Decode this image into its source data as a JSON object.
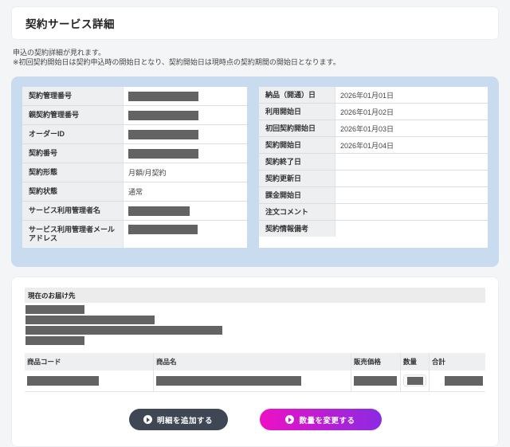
{
  "page": {
    "title": "契約サービス詳細",
    "note_line1": "申込の契約詳細が見れます。",
    "note_line2": "※初回契約開始日は契約申込時の開始日となり、契約開始日は現時点の契約期間の開始日となります。"
  },
  "contract": {
    "left_rows": [
      {
        "label": "契約管理番号",
        "value": "",
        "redacted": true
      },
      {
        "label": "親契約管理番号",
        "value": "",
        "redacted": true
      },
      {
        "label": "オーダーID",
        "value": "",
        "redacted": true
      },
      {
        "label": "契約番号",
        "value": "",
        "redacted": true
      },
      {
        "label": "契約形態",
        "value": "月額/月契約",
        "redacted": false
      },
      {
        "label": "契約状態",
        "value": "通常",
        "redacted": false
      },
      {
        "label": "サービス利用管理者名",
        "value": "",
        "redacted": true
      },
      {
        "label": "サービス利用管理者メールアドレス",
        "value": "",
        "redacted": true
      }
    ],
    "right_rows": [
      {
        "label": "納品（開通）日",
        "value": "2026年01月01日"
      },
      {
        "label": "利用開始日",
        "value": "2026年01月02日"
      },
      {
        "label": "初回契約開始日",
        "value": "2026年01月03日"
      },
      {
        "label": "契約開始日",
        "value": "2026年01月04日"
      },
      {
        "label": "契約終了日",
        "value": ""
      },
      {
        "label": "契約更新日",
        "value": ""
      },
      {
        "label": "課金開始日",
        "value": ""
      },
      {
        "label": "注文コメント",
        "value": ""
      },
      {
        "label": "契約情報備考",
        "value": ""
      }
    ]
  },
  "delivery": {
    "header": "現在のお届け先",
    "redacted_lines": 4
  },
  "products": {
    "columns": [
      "商品コード",
      "商品名",
      "販売価格",
      "数量",
      "合計"
    ],
    "rows": [
      {
        "code": "",
        "name": "",
        "price": "",
        "qty": "",
        "total": "",
        "redacted": true
      }
    ]
  },
  "buttons": {
    "add_detail": "明細を追加する",
    "change_quantity": "数量を変更する"
  },
  "colors": {
    "panel_blue": "#c8dbef",
    "dark_button": "#3e4753",
    "gradient_start": "#ee10c4",
    "gradient_end": "#8a2be2",
    "redaction_bar": "#636363",
    "label_cell": "#edeff1"
  }
}
